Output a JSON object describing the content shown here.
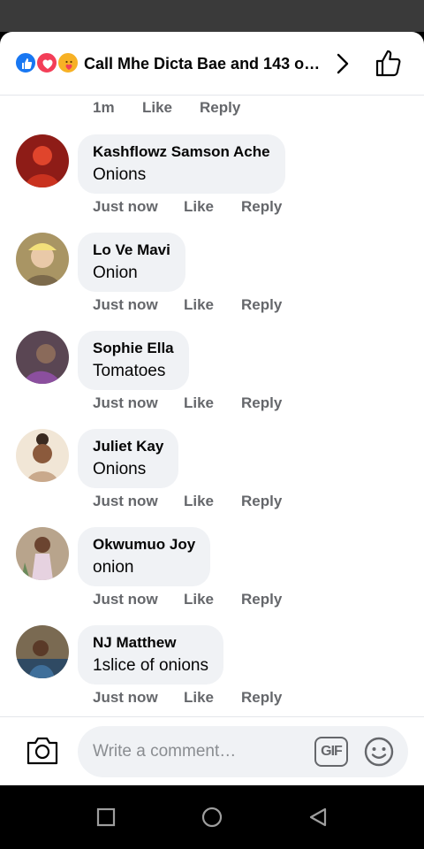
{
  "header": {
    "reaction_icons": [
      "like-icon",
      "love-icon",
      "care-icon"
    ],
    "title": "Call Mhe Dicta Bae and 143 others"
  },
  "top_meta": {
    "time": "1m",
    "like": "Like",
    "reply": "Reply"
  },
  "comments": [
    {
      "name": "Kashflowz Samson Ache",
      "text": "Onions",
      "time": "Just now",
      "like": "Like",
      "reply": "Reply",
      "avatar_color": "#b3261e"
    },
    {
      "name": "Lo Ve Mavi",
      "text": "Onion",
      "time": "Just now",
      "like": "Like",
      "reply": "Reply",
      "avatar_color": "#c8b27a"
    },
    {
      "name": "Sophie Ella",
      "text": "Tomatoes",
      "time": "Just now",
      "like": "Like",
      "reply": "Reply",
      "avatar_color": "#6b4f5e"
    },
    {
      "name": "Juliet Kay",
      "text": "Onions",
      "time": "Just now",
      "like": "Like",
      "reply": "Reply",
      "avatar_color": "#e8d6bf"
    },
    {
      "name": "Okwumuo Joy",
      "text": "onion",
      "time": "Just now",
      "like": "Like",
      "reply": "Reply",
      "avatar_color": "#a08c7a"
    },
    {
      "name": "NJ Matthew",
      "text": "1slice of onions",
      "time": "Just now",
      "like": "Like",
      "reply": "Reply",
      "avatar_color": "#3d5a6e"
    }
  ],
  "composer": {
    "placeholder": "Write a comment…",
    "gif_label": "GIF"
  },
  "colors": {
    "accent": "#1877f2",
    "love": "#f33e58",
    "bubble": "#f0f2f5",
    "meta_text": "#65676b"
  }
}
